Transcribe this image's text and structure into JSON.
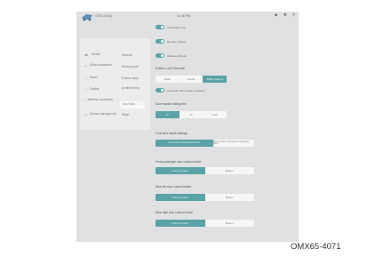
{
  "status_bar": {
    "brand": "ODEL(ASIA)",
    "time": "11:48 PM",
    "icons": [
      "wifi-icon",
      "bluetooth-icon",
      "search-icon"
    ]
  },
  "sidebar": {
    "items": [
      {
        "label": "Vehicle",
        "icon": "car-icon"
      },
      {
        "label": "Driver Assistance",
        "icon": "steering-icon"
      },
      {
        "label": "Sound",
        "icon": "speaker-icon"
      },
      {
        "label": "Display",
        "icon": "sun-icon"
      },
      {
        "label": "Wireless connection",
        "icon": "wireless-icon"
      },
      {
        "label": "Device management",
        "icon": "device-icon"
      }
    ],
    "sub_items": [
      {
        "label": "General"
      },
      {
        "label": "Driving mode"
      },
      {
        "label": "Exterior lamp"
      },
      {
        "label": "Ambient lamp"
      },
      {
        "label": "Door lock"
      },
      {
        "label": "Wiper"
      }
    ]
  },
  "toggles": [
    {
      "label": "Automatic Lock",
      "on": true
    },
    {
      "label": "Remote Unlock",
      "on": true
    },
    {
      "label": "Welcome Mode",
      "on": true
    }
  ],
  "exterior_lock_reminder": {
    "title": "Exterior Lock Reminder",
    "options": [
      "Flash",
      "Sound",
      "Flash+Sound"
    ],
    "selected": 2
  },
  "fold_mirror": {
    "label": "Auto fold mirror when unlocked",
    "on": true
  },
  "door_handle": {
    "title": "Door handle folding time",
    "options": [
      "1s",
      "2s",
      "Lock"
    ],
    "selected": 0
  },
  "four_door_unlock": {
    "title": "Four-door unlock settings",
    "options": [
      "Press twice to unlock all four doors",
      "Just one door / short press to unlock all doors"
    ],
    "selected": 0
  },
  "front_passenger": {
    "title": "Front passenger door custom button",
    "options": [
      "Press to open",
      "Button"
    ],
    "selected": 0
  },
  "rear_left": {
    "title": "Rear left door custom button",
    "options": [
      "Press to open",
      "Button"
    ],
    "selected": 0
  },
  "rear_right": {
    "title": "Rear right door custom button",
    "options": [
      "Press to open",
      "Button"
    ],
    "selected": 0
  },
  "watermark": "OMX65-4071",
  "colors": {
    "accent": "#5aa3a6",
    "panel": "#dfe1e3"
  }
}
